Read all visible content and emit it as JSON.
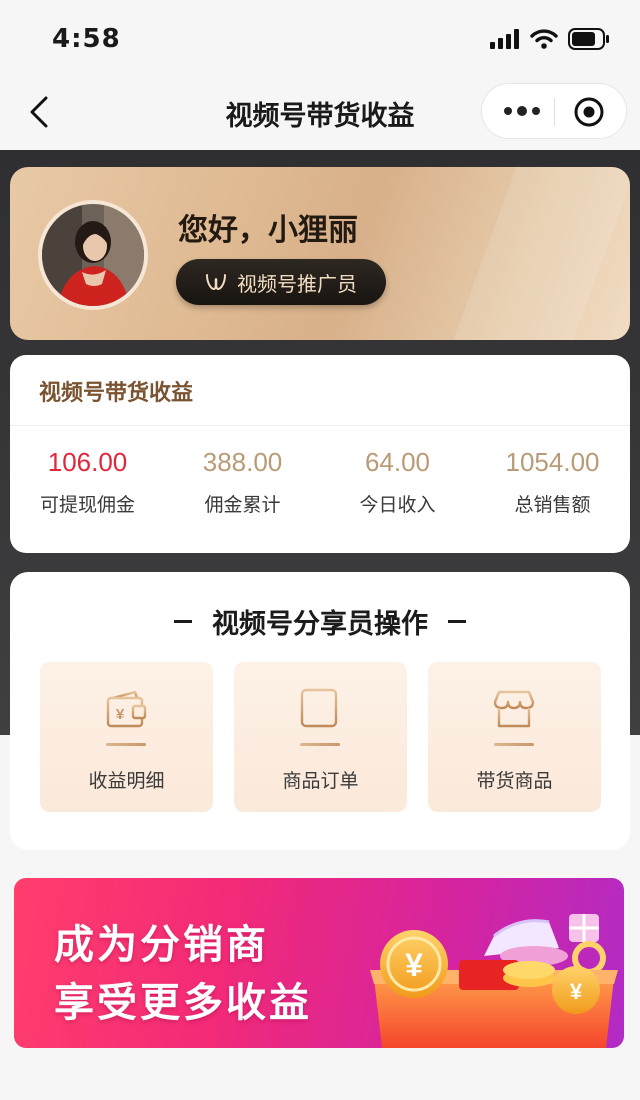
{
  "status_bar": {
    "time": "4:58"
  },
  "nav": {
    "title": "视频号带货收益"
  },
  "profile": {
    "greeting": "您好，小狸丽",
    "role": "视频号推广员"
  },
  "earnings": {
    "title": "视频号带货收益",
    "stats": [
      {
        "value": "106.00",
        "label": "可提现佣金",
        "color": "#e0283a"
      },
      {
        "value": "388.00",
        "label": "佣金累计",
        "color": "#b99b77"
      },
      {
        "value": "64.00",
        "label": "今日收入",
        "color": "#b99b77"
      },
      {
        "value": "1054.00",
        "label": "总销售额",
        "color": "#b99b77"
      }
    ]
  },
  "operations": {
    "title": "视频号分享员操作",
    "tiles": [
      {
        "label": "收益明细",
        "icon": "wallet-icon"
      },
      {
        "label": "商品订单",
        "icon": "chart-icon"
      },
      {
        "label": "带货商品",
        "icon": "store-icon"
      }
    ]
  },
  "banner": {
    "line1": "成为分销商",
    "line2": "享受更多收益",
    "art_symbol": "¥"
  }
}
